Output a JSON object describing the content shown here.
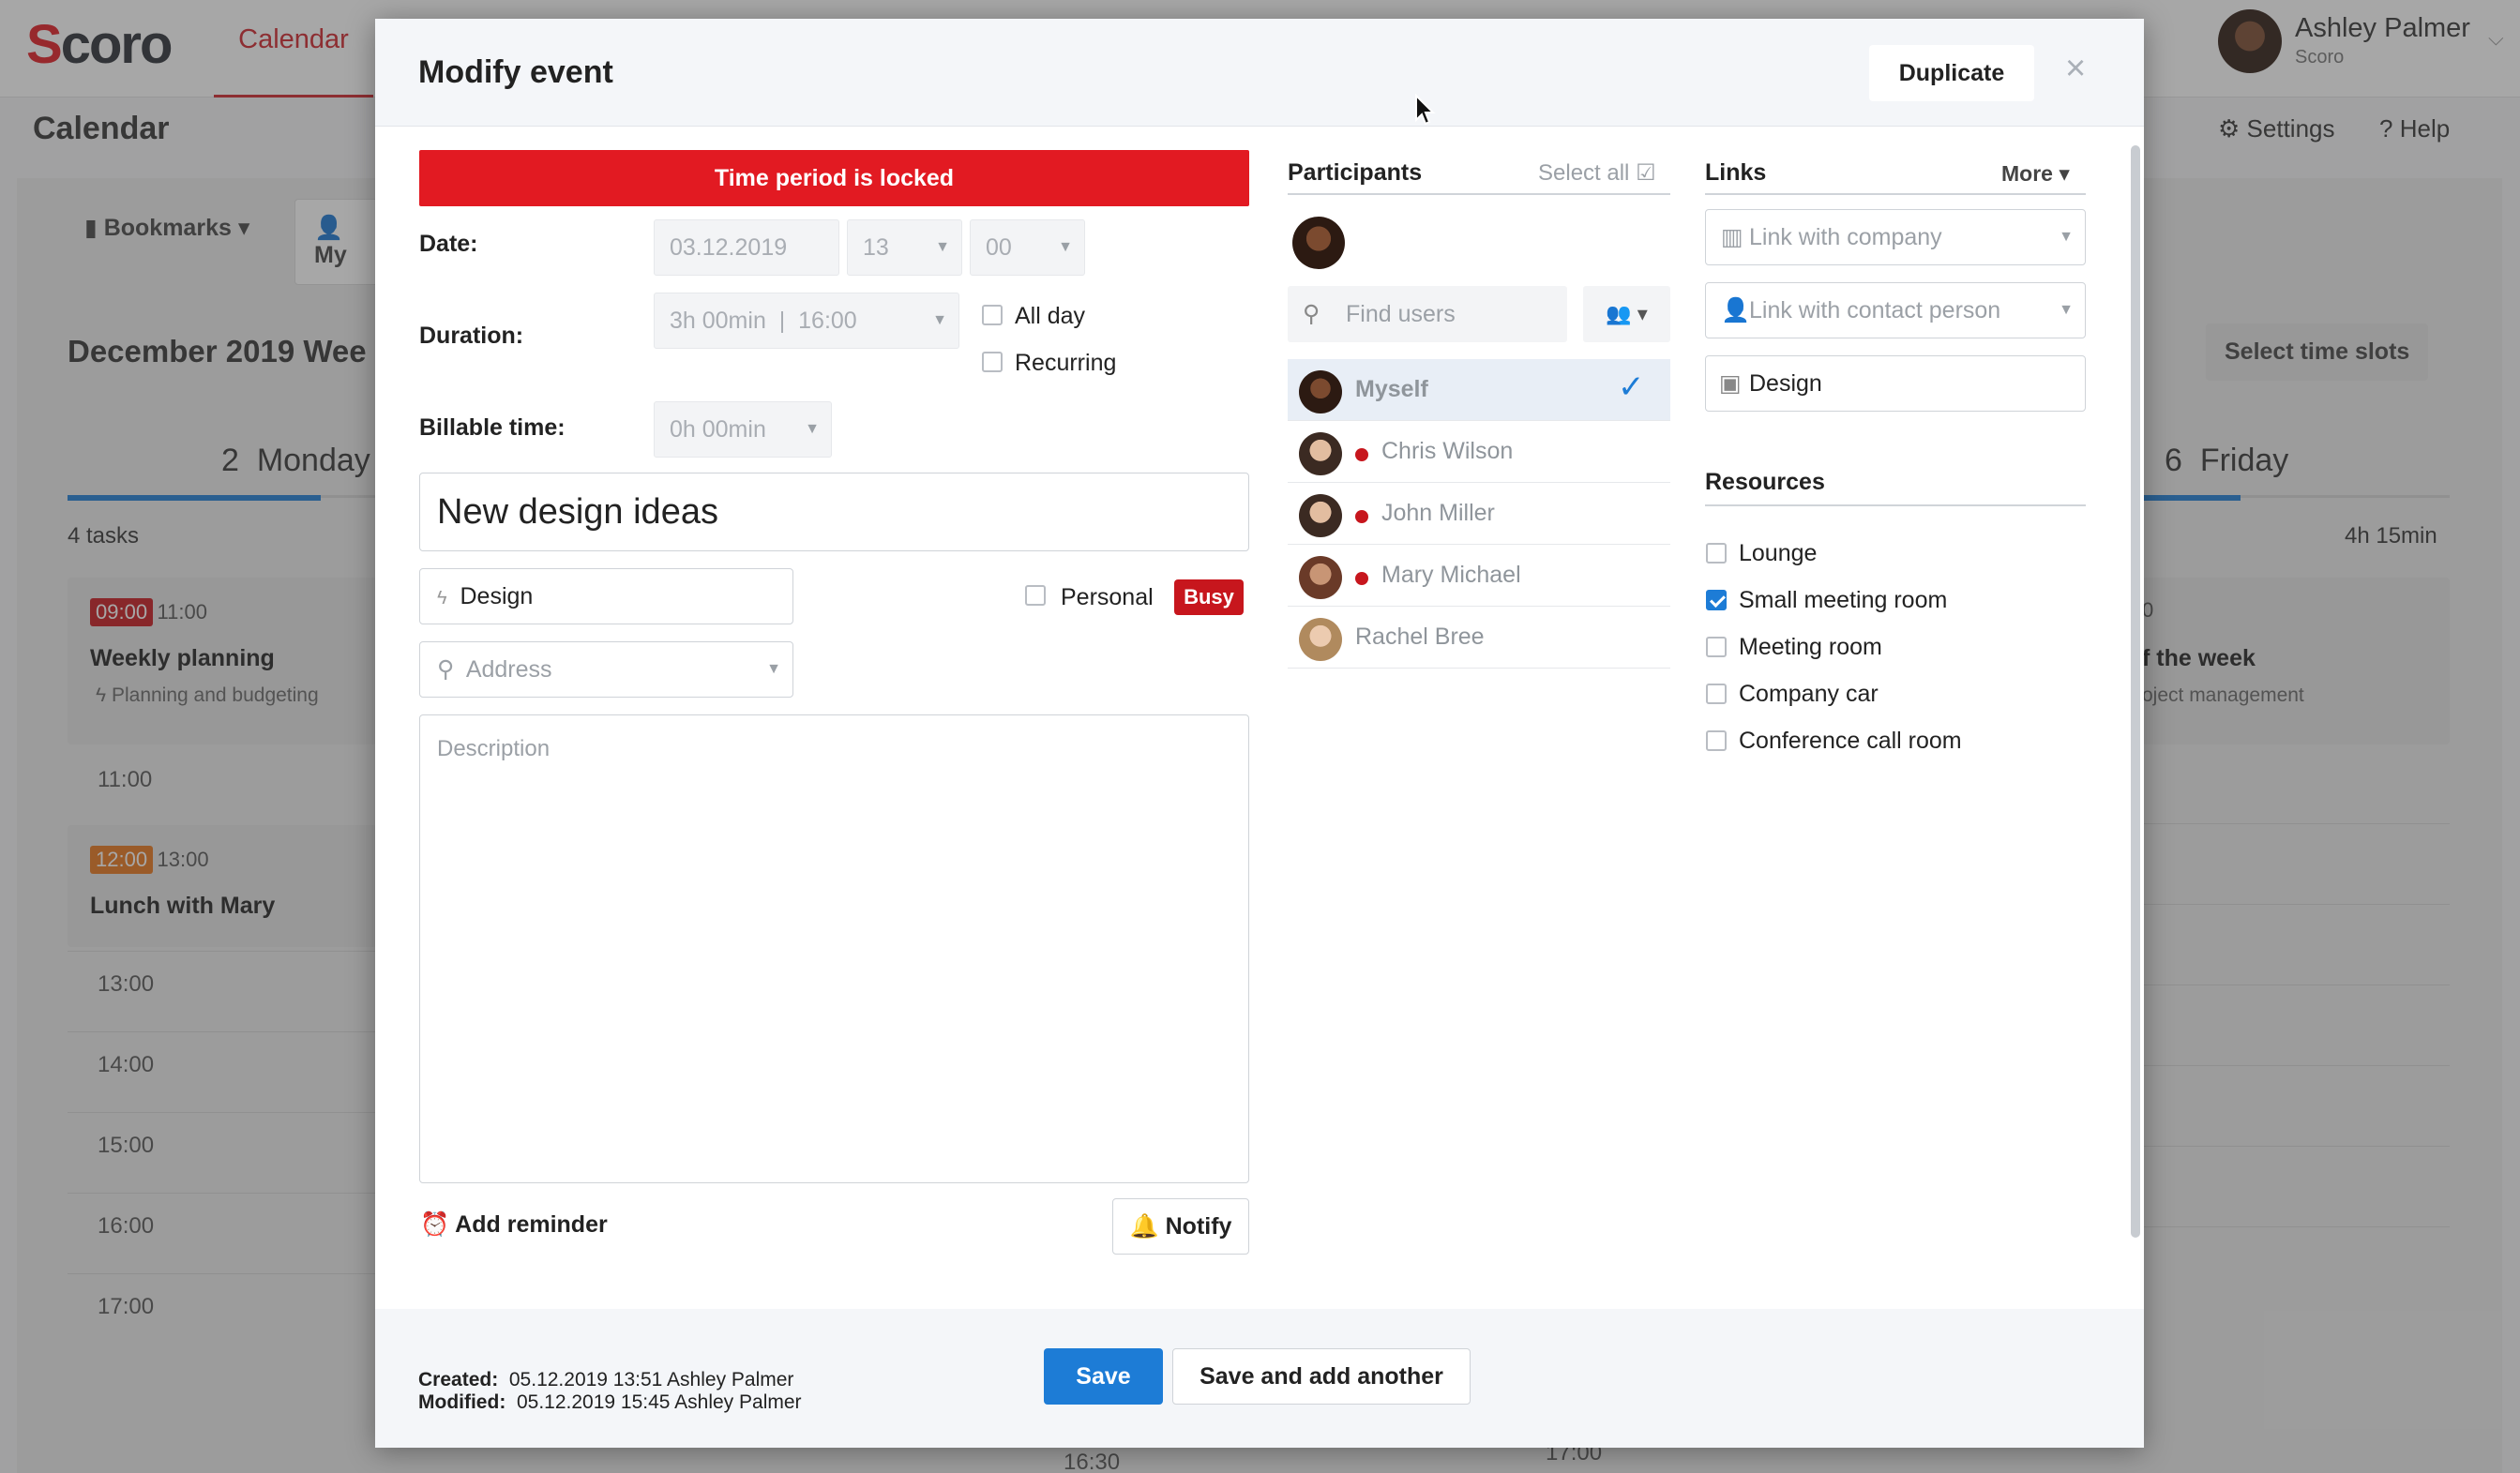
{
  "app": {
    "logo": "Scoro",
    "nav_tab": "Calendar",
    "page_title": "Calendar",
    "user_name": "Ashley Palmer",
    "user_company": "Scoro",
    "settings": "Settings",
    "help": "Help",
    "bookmarks": "Bookmarks",
    "my_label": "My",
    "week_title": "December 2019 Wee",
    "select_time_slots": "Select time slots",
    "monday": {
      "num": "2",
      "name": "Monday",
      "tasks": "4 tasks"
    },
    "friday": {
      "num": "6",
      "name": "Friday",
      "total": "4h 15min"
    },
    "events": [
      {
        "start": "09:00",
        "end": "11:00",
        "title": "Weekly planning",
        "project": "Planning and budgeting",
        "tag_color": "#c7161d"
      },
      {
        "start": "12:00",
        "end": "13:00",
        "title": "Lunch with Mary",
        "tag_color": "#e8761a"
      }
    ],
    "friday_event": {
      "time": "0",
      "title": "f the week",
      "project": "oject management"
    },
    "hours": [
      "11:00",
      "13:00",
      "14:00",
      "15:00",
      "16:00",
      "17:00"
    ],
    "bottom_times": [
      "16:30",
      "17:00"
    ]
  },
  "modal": {
    "title": "Modify event",
    "duplicate": "Duplicate",
    "close": "×",
    "locked_banner": "Time period is locked",
    "date_label": "Date:",
    "date_value": "03.12.2019",
    "hour_value": "13",
    "minute_value": "00",
    "duration_label": "Duration:",
    "duration_value": "3h 00min",
    "duration_end": "16:00",
    "all_day": "All day",
    "recurring": "Recurring",
    "billable_label": "Billable time:",
    "billable_value": "0h 00min",
    "event_title": "New design ideas",
    "activity_type": "Design",
    "personal": "Personal",
    "busy": "Busy",
    "address_placeholder": "Address",
    "description_placeholder": "Description",
    "add_reminder": "Add reminder",
    "notify": "Notify",
    "participants": {
      "heading": "Participants",
      "select_all": "Select all",
      "find_placeholder": "Find users",
      "people": [
        {
          "name": "Myself",
          "selected": true,
          "busy": false
        },
        {
          "name": "Chris Wilson",
          "selected": false,
          "busy": true
        },
        {
          "name": "John Miller",
          "selected": false,
          "busy": true
        },
        {
          "name": "Mary Michael",
          "selected": false,
          "busy": true
        },
        {
          "name": "Rachel Bree",
          "selected": false,
          "busy": false
        }
      ]
    },
    "links": {
      "heading": "Links",
      "more": "More",
      "company_placeholder": "Link with company",
      "contact_placeholder": "Link with contact person",
      "project": "Design"
    },
    "resources": {
      "heading": "Resources",
      "items": [
        {
          "label": "Lounge",
          "checked": false
        },
        {
          "label": "Small meeting room",
          "checked": true
        },
        {
          "label": "Meeting room",
          "checked": false
        },
        {
          "label": "Company car",
          "checked": false
        },
        {
          "label": "Conference call room",
          "checked": false
        }
      ]
    },
    "footer": {
      "created_label": "Created:",
      "created_value": "05.12.2019 13:51 Ashley Palmer",
      "modified_label": "Modified:",
      "modified_value": "05.12.2019 15:45 Ashley Palmer",
      "save": "Save",
      "save_add": "Save and add another"
    }
  },
  "colors": {
    "brand_red": "#e21a22",
    "primary_blue": "#1d7cd6",
    "busy_red": "#c7161d"
  }
}
